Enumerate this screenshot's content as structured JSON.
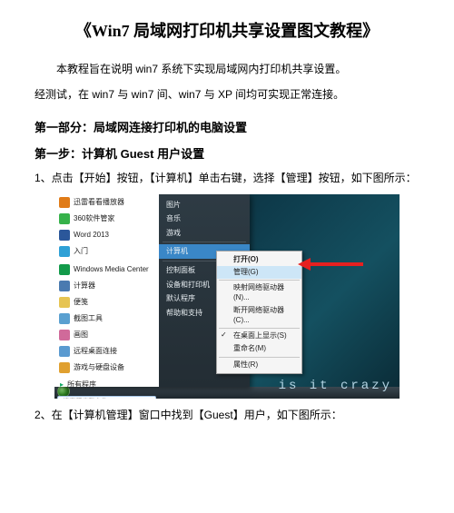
{
  "title": "《Win7 局域网打印机共享设置图文教程》",
  "intro_line1": "本教程旨在说明 win7 系统下实现局域网内打印机共享设置。",
  "intro_line2": "经测试，在 win7 与 win7 间、win7 与 XP 间均可实现正常连接。",
  "section1_heading": "第一部分：局域网连接打印机的电脑设置",
  "step1_heading": "第一步：计算机 Guest 用户设置",
  "step1_line1": "1、点击【开始】按钮，【计算机】单击右键，选择【管理】按钮，如下图所示：",
  "step2_line": "2、在【计算机管理】窗口中找到【Guest】用户，如下图所示：",
  "screenshot": {
    "desktop_watermark": "is it crazy",
    "start_left_items": [
      {
        "label": "迅雷看看播放器",
        "color": "#e07b18"
      },
      {
        "label": "360软件管家",
        "color": "#36b24a"
      },
      {
        "label": "Word 2013",
        "color": "#2b579a"
      },
      {
        "label": "入门",
        "color": "#2ea0d6"
      },
      {
        "label": "Windows Media Center",
        "color": "#129a4a"
      },
      {
        "label": "计算器",
        "color": "#4a7ab0"
      },
      {
        "label": "便笺",
        "color": "#e6c452"
      },
      {
        "label": "截图工具",
        "color": "#5aa0d0"
      },
      {
        "label": "画图",
        "color": "#d06a9a"
      },
      {
        "label": "远程桌面连接",
        "color": "#5a9ad0"
      },
      {
        "label": "游戏与硬盘设备",
        "color": "#e0a030"
      }
    ],
    "start_left_all": "所有程序",
    "start_left_search": "搜索程序和文件",
    "start_right_items": [
      "图片",
      "音乐",
      "游戏",
      "",
      "计算机",
      "",
      "控制面板",
      "设备和打印机",
      "默认程序",
      "帮助和支持"
    ],
    "start_right_highlight_index": 4,
    "context_menu": {
      "items": [
        {
          "label": "打开(O)",
          "bold": true
        },
        {
          "label": "管理(G)",
          "hl": true
        },
        {
          "label": "-"
        },
        {
          "label": "映射网络驱动器(N)..."
        },
        {
          "label": "断开网络驱动器(C)..."
        },
        {
          "label": "-"
        },
        {
          "label": "在桌面上显示(S)",
          "check": true
        },
        {
          "label": "重命名(M)"
        },
        {
          "label": "-"
        },
        {
          "label": "属性(R)"
        }
      ]
    }
  }
}
